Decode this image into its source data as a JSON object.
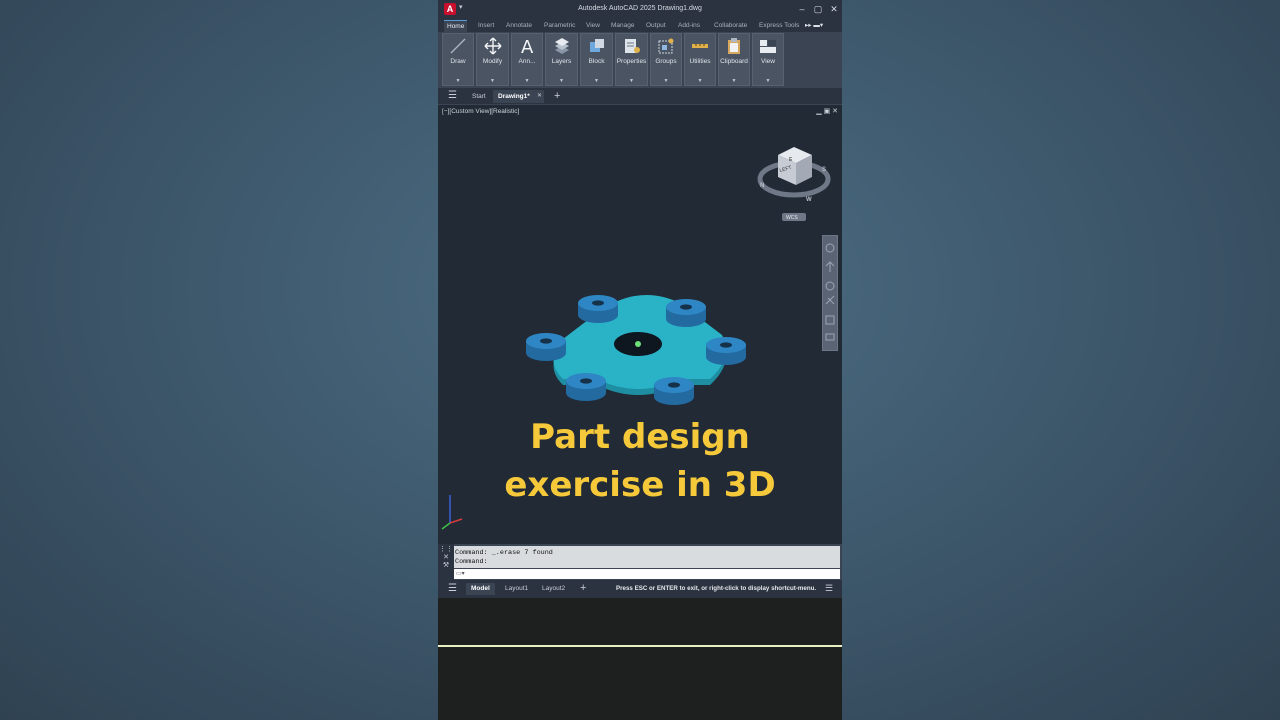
{
  "titlebar": {
    "logo": "A",
    "title": "Autodesk AutoCAD 2025    Drawing1.dwg",
    "controls": [
      "–",
      "▢",
      "✕"
    ]
  },
  "ribbon_tabs": [
    "Home",
    "Insert",
    "Annotate",
    "Parametric",
    "View",
    "Manage",
    "Output",
    "Add-ins",
    "Collaborate",
    "Express Tools"
  ],
  "ribbon_buttons": [
    "Draw",
    "Modify",
    "Ann...",
    "Layers",
    "Block",
    "Properties",
    "Groups",
    "Utilities",
    "Clipboard",
    "View"
  ],
  "doc_tabs": {
    "start": "Start",
    "active": "Drawing1*",
    "close": "✕",
    "add": "+"
  },
  "viewport": {
    "label": "[−][Custom View][Realistic]",
    "controls": "▁ ▣ ✕",
    "viewcube_face": "LEFT",
    "compass": [
      "N",
      "W",
      "S",
      "E"
    ],
    "wcs_label": "WCS",
    "overlay_line1": "Part design",
    "overlay_line2": "exercise in 3D"
  },
  "command": {
    "history": [
      "Command: _.erase 7 found",
      "Command:"
    ],
    "prompt_placeholder": ""
  },
  "layout_tabs": {
    "model": "Model",
    "layout1": "Layout1",
    "layout2": "Layout2",
    "add": "+"
  },
  "status_message": "Press ESC or ENTER to exit, or right-click to display shortcut-menu.",
  "colors": {
    "overlay_text": "#f6c93a",
    "part_body": "#2ab3c6",
    "part_bosses": "#2f86c4",
    "autocad_red": "#c8102e"
  }
}
